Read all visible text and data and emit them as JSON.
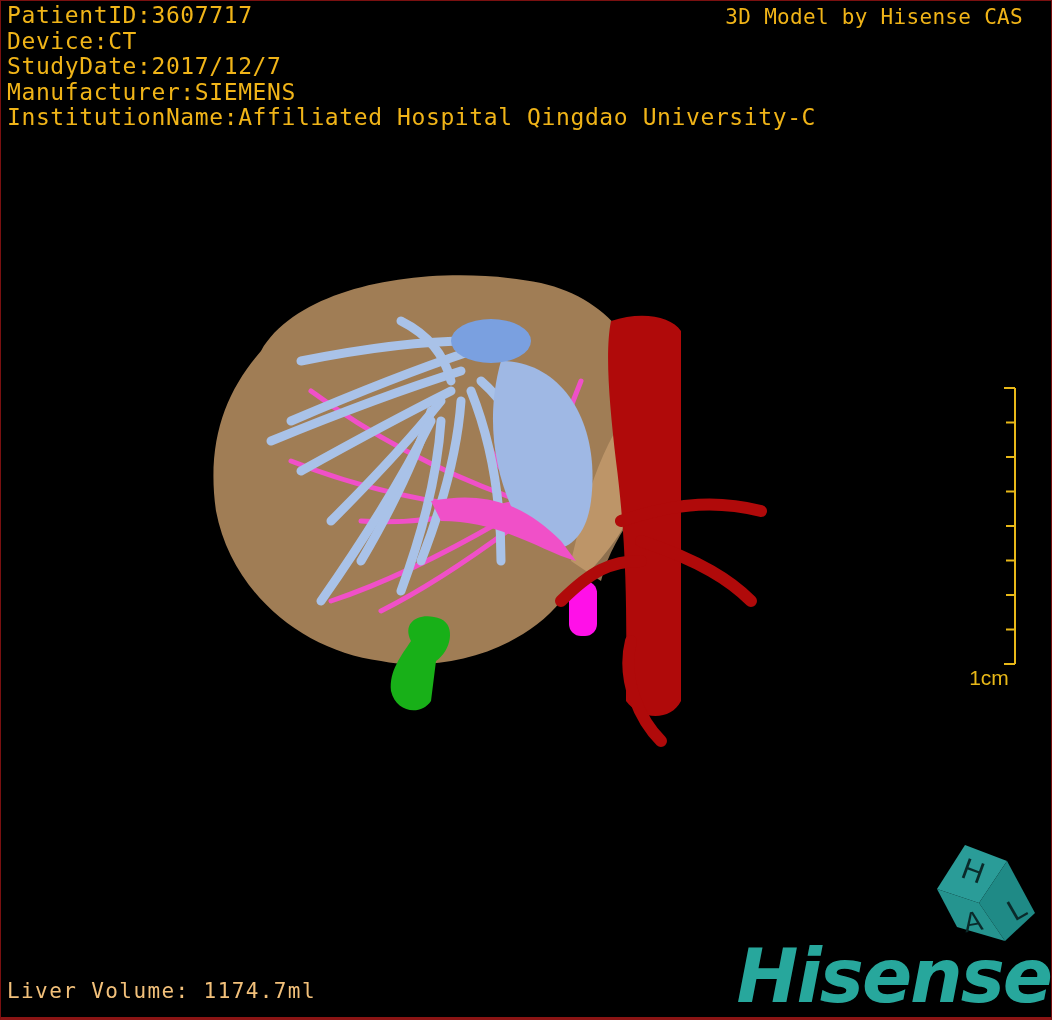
{
  "patient_info": [
    {
      "label": "PatientID:",
      "value": "3607717"
    },
    {
      "label": "Device:",
      "value": "CT"
    },
    {
      "label": "StudyDate:",
      "value": "2017/12/7"
    },
    {
      "label": "Manufacturer:",
      "value": "SIEMENS"
    },
    {
      "label": "InstitutionName:",
      "value": "Affiliated Hospital Qingdao University-C"
    }
  ],
  "viewer_title": "3D Model by Hisense CAS",
  "scale_bar": {
    "label": "1cm"
  },
  "orientation_cube": {
    "faces": [
      "H",
      "A",
      "L"
    ]
  },
  "brand": "Hisense",
  "measurement": {
    "label": "Liver Volume:",
    "value": "1174.7ml"
  }
}
